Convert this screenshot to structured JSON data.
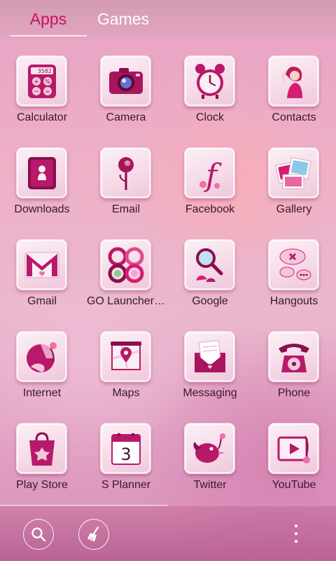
{
  "tabs": [
    {
      "label": "Apps",
      "selected": true
    },
    {
      "label": "Games",
      "selected": false
    }
  ],
  "apps": [
    {
      "label": "Calculator",
      "icon": "calculator-icon",
      "display_value": "3582"
    },
    {
      "label": "Camera",
      "icon": "camera-icon"
    },
    {
      "label": "Clock",
      "icon": "alarm-clock-icon"
    },
    {
      "label": "Contacts",
      "icon": "contacts-girl-icon"
    },
    {
      "label": "Downloads",
      "icon": "downloads-icon"
    },
    {
      "label": "Email",
      "icon": "email-rose-icon"
    },
    {
      "label": "Facebook",
      "icon": "facebook-icon"
    },
    {
      "label": "Gallery",
      "icon": "gallery-photos-icon"
    },
    {
      "label": "Gmail",
      "icon": "gmail-envelope-icon"
    },
    {
      "label": "GO Launcher…",
      "icon": "go-launcher-icon"
    },
    {
      "label": "Google",
      "icon": "google-magnifier-icon"
    },
    {
      "label": "Hangouts",
      "icon": "hangouts-bubbles-icon"
    },
    {
      "label": "Internet",
      "icon": "internet-globe-icon"
    },
    {
      "label": "Maps",
      "icon": "maps-pin-icon"
    },
    {
      "label": "Messaging",
      "icon": "messaging-letter-icon"
    },
    {
      "label": "Phone",
      "icon": "rotary-phone-icon"
    },
    {
      "label": "Play Store",
      "icon": "play-store-bag-icon"
    },
    {
      "label": "S Planner",
      "icon": "calendar-icon",
      "calendar_day": "3"
    },
    {
      "label": "Twitter",
      "icon": "twitter-bird-icon"
    },
    {
      "label": "YouTube",
      "icon": "youtube-play-icon"
    }
  ],
  "dock": {
    "search_icon": "search-icon",
    "clean_icon": "broom-icon",
    "menu_icon": "more-vertical-icon"
  },
  "colors": {
    "accent": "#c4145e",
    "icon_pink": "#b8196a",
    "icon_dark": "#8a0f4c"
  }
}
